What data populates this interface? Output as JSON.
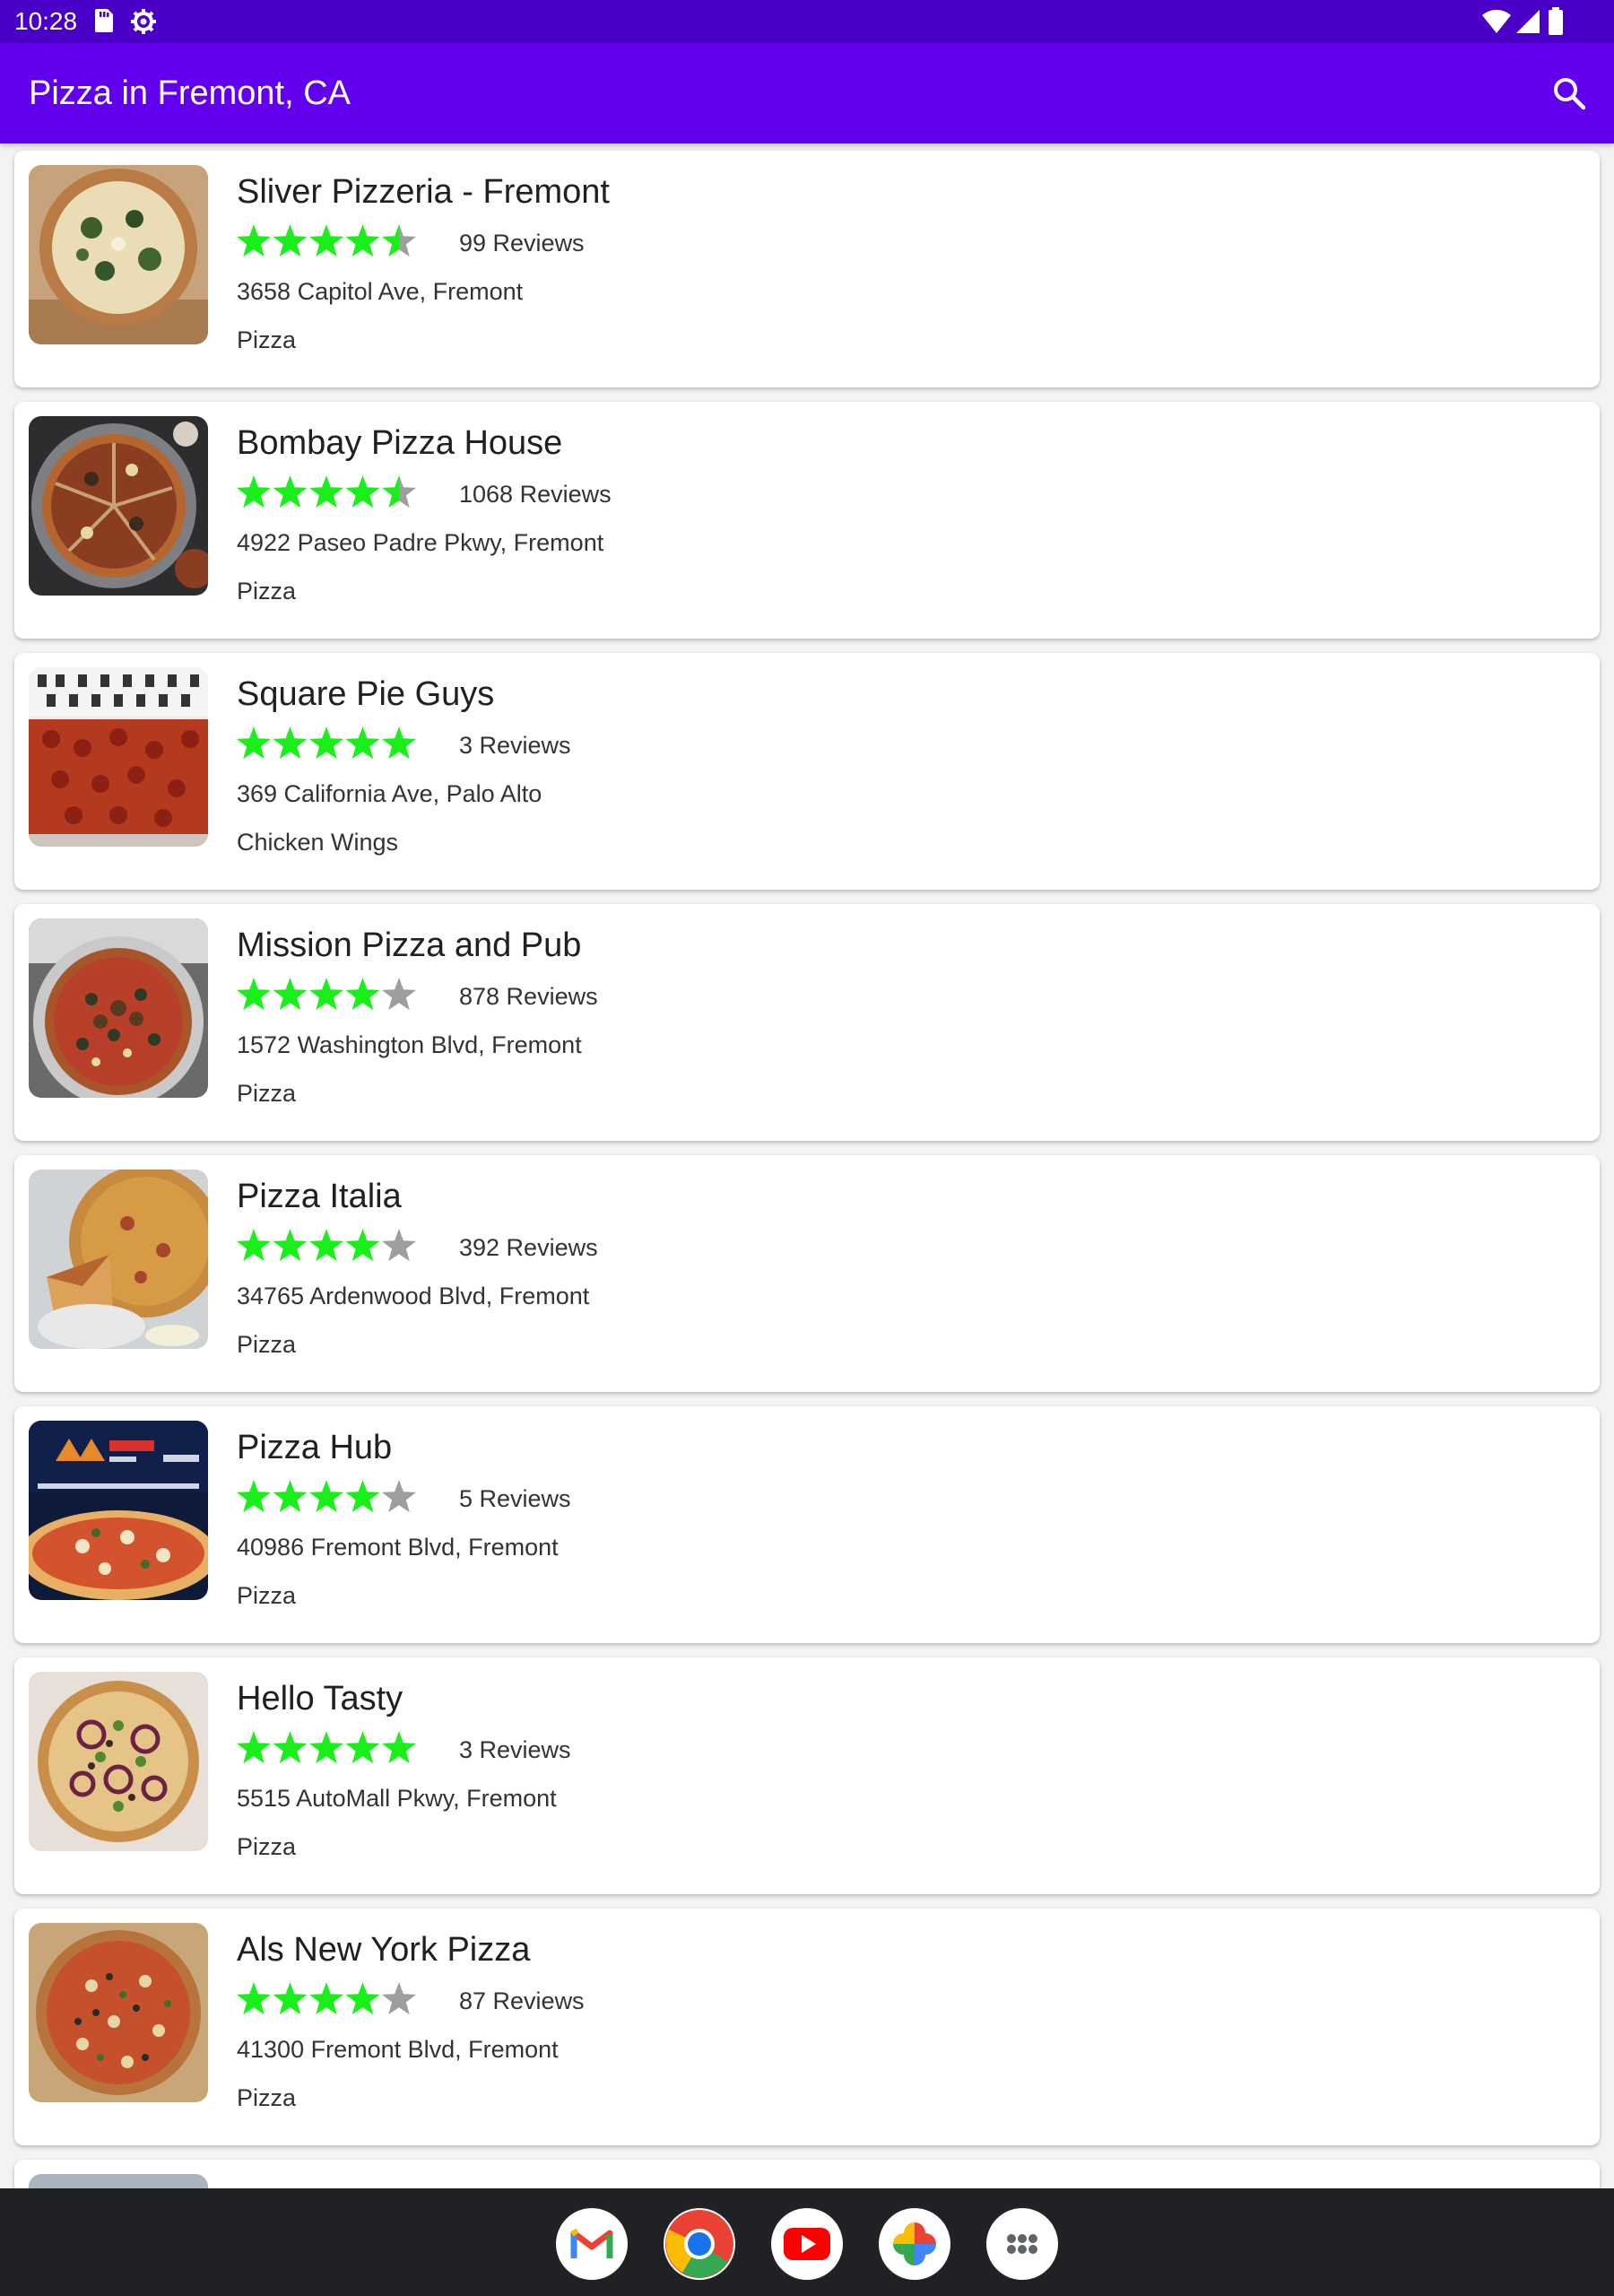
{
  "status_bar": {
    "time": "10:28"
  },
  "app_bar": {
    "title": "Pizza in Fremont, CA"
  },
  "colors": {
    "app_bar": "#6200ee",
    "status_bar": "#4a00c6",
    "star_filled": "#1aef1a",
    "star_empty": "#9e9e9e",
    "dock": "#202124"
  },
  "restaurants": [
    {
      "name": "Sliver Pizzeria - Fremont",
      "rating": 4.5,
      "reviews": "99 Reviews",
      "address": "3658 Capitol Ave, Fremont",
      "category": "Pizza"
    },
    {
      "name": "Bombay Pizza House",
      "rating": 4.5,
      "reviews": "1068 Reviews",
      "address": "4922 Paseo Padre Pkwy, Fremont",
      "category": "Pizza"
    },
    {
      "name": "Square Pie Guys",
      "rating": 5,
      "reviews": "3 Reviews",
      "address": "369 California Ave, Palo Alto",
      "category": "Chicken Wings"
    },
    {
      "name": "Mission Pizza and Pub",
      "rating": 4,
      "reviews": "878 Reviews",
      "address": "1572 Washington Blvd, Fremont",
      "category": "Pizza"
    },
    {
      "name": "Pizza Italia",
      "rating": 4,
      "reviews": "392 Reviews",
      "address": "34765 Ardenwood Blvd, Fremont",
      "category": "Pizza"
    },
    {
      "name": "Pizza Hub",
      "rating": 4,
      "reviews": "5 Reviews",
      "address": "40986 Fremont Blvd, Fremont",
      "category": "Pizza"
    },
    {
      "name": "Hello Tasty",
      "rating": 5,
      "reviews": "3 Reviews",
      "address": "5515 AutoMall Pkwy, Fremont",
      "category": "Pizza"
    },
    {
      "name": "Als New York Pizza",
      "rating": 4,
      "reviews": "87 Reviews",
      "address": "41300 Fremont Blvd, Fremont",
      "category": "Pizza"
    }
  ],
  "dock": {
    "apps": [
      {
        "icon": "gmail-icon"
      },
      {
        "icon": "chrome-icon"
      },
      {
        "icon": "youtube-icon"
      },
      {
        "icon": "photos-icon"
      },
      {
        "icon": "app-drawer-icon"
      }
    ]
  }
}
